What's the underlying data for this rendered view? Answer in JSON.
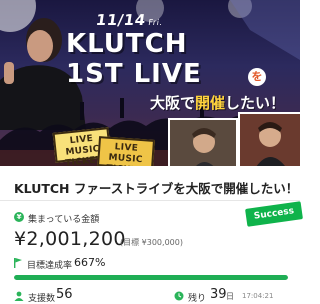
{
  "hero": {
    "date": "11/14",
    "day": "Fri.",
    "title_line1": "KLUTCH",
    "title_line2": "1ST LIVE",
    "title_particle": "を",
    "subtitle_city": "大阪",
    "subtitle_mid": "で",
    "subtitle_hi": "開催",
    "subtitle_end": "したい！",
    "ticket1_label": "LIVE MUSIC TICKET",
    "ticket2_label": "LIVE MUSIC TICKET"
  },
  "project": {
    "title": "KLUTCH ファーストライブを大阪で開催したい！",
    "status_badge": "Success"
  },
  "funding": {
    "raised_label": "集まっている金額",
    "raised_amount": "¥2,001,200",
    "goal_text": "(目標 ¥300,000)",
    "rate_label": "目標達成率",
    "rate_value": "667%",
    "progress_fraction": 1.0
  },
  "stats": {
    "supporters_label": "支援数",
    "supporters_value": "56",
    "remaining_label": "残り",
    "remaining_value": "39",
    "remaining_unit": "日",
    "deadline_time": "17:04:21"
  },
  "colors": {
    "accent_green": "#1fae55",
    "badge_green": "#0fb34b"
  }
}
